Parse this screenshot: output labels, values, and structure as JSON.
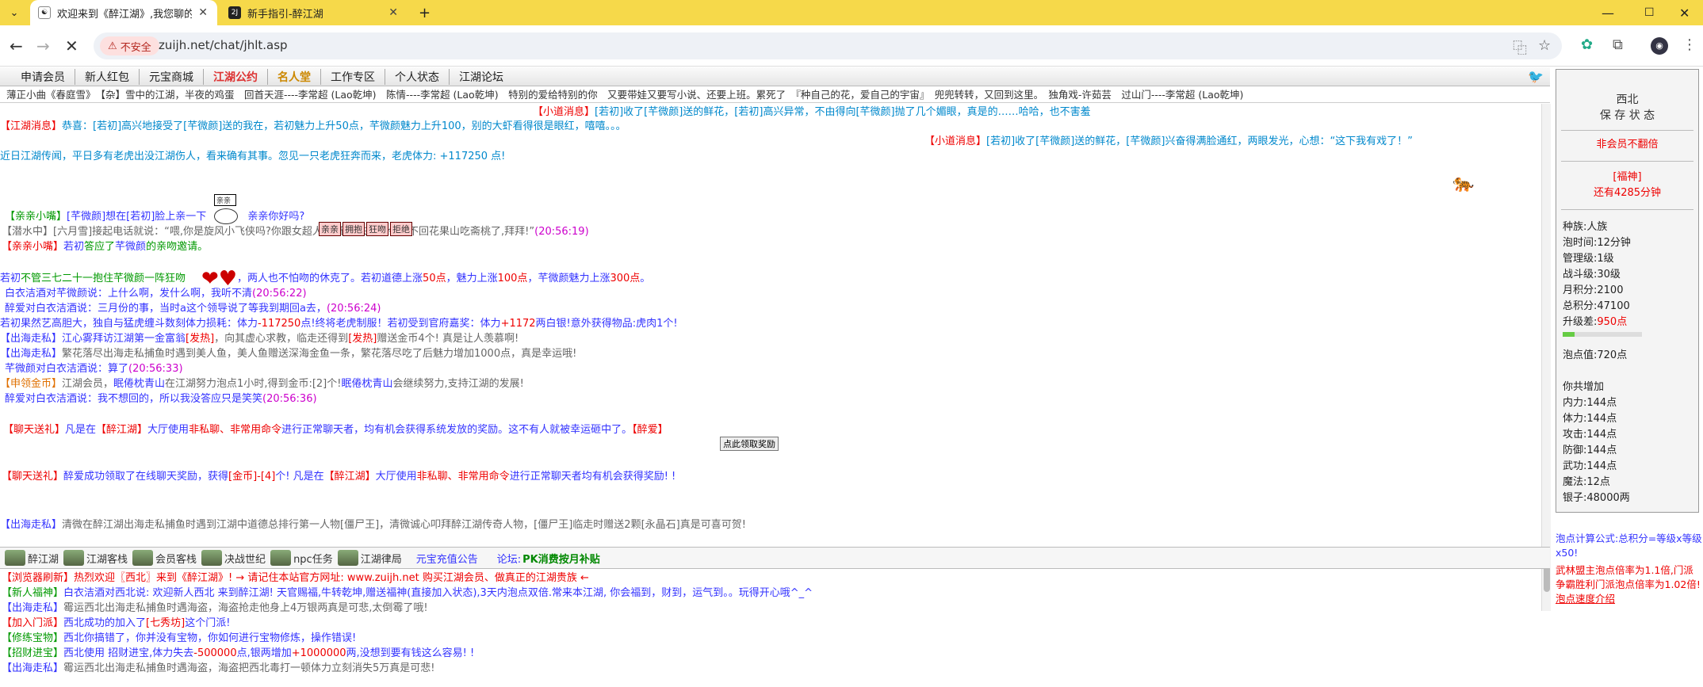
{
  "browser": {
    "tabs": [
      {
        "title": "欢迎来到《醉江湖》,我您聊的天",
        "active": true
      },
      {
        "title": "新手指引-醉江湖",
        "active": false
      }
    ],
    "new_tab": "+",
    "security": "不安全",
    "url": "zuijh.net/chat/jhlt.asp"
  },
  "menu": [
    "申请会员",
    "新人红包",
    "元宝商城",
    "江湖公约",
    "名人堂",
    "工作专区",
    "个人状态",
    "江湖论坛"
  ],
  "ticker": "薄正小曲《春庭雪》　【杂】雪中的江湖，半夜的鸡蛋　回首天涯----李常超 (Lao乾坤)　陈情----李常超 (Lao乾坤)　特别的爱给特别的你　又要带娃又要写小说、还要上班。累死了　『种自己的花，爱自己的宇宙』　兜兜转转，又回到这里。　独角戏-许茹芸　过山门----李常超 (Lao乾坤)",
  "chat": [
    {
      "id": "m1",
      "parts": [
        [
          "r",
          "【小道消息】"
        ],
        [
          "t",
          "[若初]收了[芊微颜]送的鲜花，[若初]高兴异常，不由得向[芊微颜]抛了几个媚眼，真是的……哈哈，也不害羞"
        ]
      ]
    },
    {
      "id": "m2",
      "parts": [
        [
          "r",
          "【江湖消息】"
        ],
        [
          "t",
          "恭喜：[若初]高兴地接受了[芊微颜]送的我在，若初魅力上升50点，芊微颜魅力上升100，别的大虾看得很是眼红，嘻嘻。。。"
        ]
      ]
    },
    {
      "id": "m3",
      "parts": [
        [
          "r",
          "【小道消息】"
        ],
        [
          "t",
          "[若初]收了[芊微颜]送的鲜花，[芊微颜]兴奋得满脸通红，两眼发光，心想：“这下我有戏了！”"
        ]
      ]
    },
    {
      "id": "m4",
      "parts": [
        [
          "t",
          "近日江湖传闻，平日多有老虎出没江湖伤人，看来确有其事。忽见一只老虎狂奔而来，老虎体力: +117250 点!"
        ]
      ]
    },
    {
      "id": "m5",
      "parts": [
        [
          "g",
          "【亲亲小嘴】"
        ],
        [
          "b",
          "[芊微颜]想在[若初]脸上亲一下"
        ],
        [
          "b",
          "　　　　亲亲你好吗?"
        ]
      ]
    },
    {
      "id": "m6",
      "parts": [
        [
          "gr",
          "【潜水中】[六月雪]接起电话就说：“喂,你是旋风小飞侠吗?你跟女超人说,无敌铁金刚今天不回花果山吃斋桃了,拜拜!”"
        ],
        [
          "p",
          "(20:56:19)"
        ]
      ]
    },
    {
      "id": "m7",
      "parts": [
        [
          "r",
          "【亲亲小嘴】"
        ],
        [
          "b",
          "若初"
        ],
        [
          "g",
          "答应了"
        ],
        [
          "b",
          "芊微颜"
        ],
        [
          "g",
          "的亲吻邀请。"
        ]
      ]
    },
    {
      "id": "m8",
      "parts": [
        [
          "b",
          "若初"
        ],
        [
          "g",
          "不管三七二十一抱住芊微颜一阵狂吻"
        ],
        [
          "b",
          "　　　　　，两人也不怕吻的休克了。若初道德上涨"
        ],
        [
          "r",
          "50点"
        ],
        [
          "b",
          "，魅力上涨"
        ],
        [
          "r",
          "100点"
        ],
        [
          "b",
          "，芊微颜魅力上涨"
        ],
        [
          "r",
          "300点"
        ],
        [
          "b",
          "。"
        ]
      ]
    },
    {
      "id": "m9",
      "parts": [
        [
          "b",
          "白衣洁酒对芊微颜说：上什么啊，发什么啊，我听不清"
        ],
        [
          "p",
          "(20:56:22)"
        ]
      ]
    },
    {
      "id": "m10",
      "parts": [
        [
          "b",
          "醉爱对白衣洁酒说：三月份的事，当时a这个领导说了等我到期回a去，"
        ],
        [
          "p",
          "(20:56:24)"
        ]
      ]
    },
    {
      "id": "m11",
      "parts": [
        [
          "b",
          "若初果然艺高胆大，独自与猛虎缠斗数刻体力损耗：体力"
        ],
        [
          "r",
          "-117250"
        ],
        [
          "b",
          "点!终将老虎制服！若初受到官府嘉奖：体力"
        ],
        [
          "r",
          "+1172"
        ],
        [
          "b",
          "两白银!意外获得物品:虎肉1个!"
        ]
      ]
    },
    {
      "id": "m12",
      "parts": [
        [
          "b",
          "【出海走私】江心雾拜访江湖第一金富翁"
        ],
        [
          "r",
          "[发热]"
        ],
        [
          "gr",
          "，向其虚心求教，临走还得到"
        ],
        [
          "r",
          "[发热]"
        ],
        [
          "gr",
          "赠送金币4个! 真是让人羡慕啊!"
        ]
      ]
    },
    {
      "id": "m13",
      "parts": [
        [
          "b",
          "【出海走私】"
        ],
        [
          "gr",
          "繁花落尽出海走私捕鱼时遇到美人鱼，美人鱼赠送深海金鱼一条，繁花落尽吃了后魅力增加1000点，真是幸运哦!"
        ]
      ]
    },
    {
      "id": "m14",
      "parts": [
        [
          "b",
          "芊微颜对白衣洁酒说：算了"
        ],
        [
          "p",
          "(20:56:33)"
        ]
      ]
    },
    {
      "id": "m15",
      "parts": [
        [
          "o",
          "【申领金币】"
        ],
        [
          "gr",
          "江湖会员，"
        ],
        [
          "b",
          "眠倦枕青山"
        ],
        [
          "gr",
          "在江湖努力泡点1小时,得到金币:[2]个!"
        ],
        [
          "b",
          "眠倦枕青山"
        ],
        [
          "gr",
          "会继续努力,支持江湖的发展!"
        ]
      ]
    },
    {
      "id": "m16",
      "parts": [
        [
          "b",
          "醉爱对白衣洁酒说：我不想回的，所以我没答应只是笑笑"
        ],
        [
          "p",
          "(20:56:36)"
        ]
      ]
    },
    {
      "id": "m17",
      "parts": [
        [
          "r",
          "【聊天送礼】"
        ],
        [
          "b",
          "凡是在"
        ],
        [
          "r",
          "【醉江湖】"
        ],
        [
          "b",
          "大厅使用"
        ],
        [
          "r",
          "非私聊、非常用命令"
        ],
        [
          "b",
          "进行正常聊天者，均有机会获得系统发放的奖励。这不有人就被幸运砸中了。"
        ],
        [
          "r",
          "【醉爱】"
        ]
      ]
    },
    {
      "id": "m18",
      "parts": [
        [
          "r",
          "【聊天送礼】"
        ],
        [
          "b",
          "醉爱成功领取了在线聊天奖励，获得"
        ],
        [
          "r",
          "[金币]-[4]"
        ],
        [
          "b",
          "个! 凡是在"
        ],
        [
          "r",
          "【醉江湖】"
        ],
        [
          "b",
          "大厅使用"
        ],
        [
          "r",
          "非私聊、非常用命令"
        ],
        [
          "b",
          "进行正常聊天者均有机会获得奖励! !"
        ]
      ]
    },
    {
      "id": "m19",
      "parts": [
        [
          "b",
          "【出海走私】"
        ],
        [
          "gr",
          "清微在醉江湖出海走私捕鱼时遇到江湖中道德总排行第一人物[僵尸王]，清微诚心叩拜醉江湖传奇人物，[僵尸王]临走时赠送2颗[永晶石]真是可喜可贺!"
        ]
      ]
    }
  ],
  "emotes": [
    "亲亲",
    "拥抱",
    "狂吻",
    "拒绝"
  ],
  "kiss_note": "亲亲",
  "claim_btn": "点此领取奖励",
  "nav": [
    "醉江湖",
    "江湖客栈",
    "会员客栈",
    "决战世纪",
    "npc任务",
    "江湖律局",
    "元宝充值公告",
    "论坛: ",
    "PK消费按月补贴"
  ],
  "sys": [
    {
      "parts": [
        [
          "r",
          "【浏览器刷新】热烈欢迎〖西北〗来到《醉江湖》! → 请记住本站官方网址: www.zuijh.net 购买江湖会员、做真正的江湖贵族 ←"
        ]
      ]
    },
    {
      "parts": [
        [
          "g",
          "【新人福神】"
        ],
        [
          "b",
          "白衣洁酒对西北说: 欢迎新人西北 来到醉江湖! 天官赐福,牛转乾坤,赠送福神(直接加入状态),3天内泡点双倍.常来本江湖, 你会福到，财到，运气到。。玩得开心哦^_^"
        ]
      ]
    },
    {
      "parts": [
        [
          "b",
          "【出海走私】"
        ],
        [
          "gr",
          "霉运西北出海走私捕鱼时遇海盗，海盗抢走他身上4万银两真是可悲,太倒霉了哦!"
        ]
      ]
    },
    {
      "parts": [
        [
          "r",
          "【加入门派】"
        ],
        [
          "b",
          "西北成功的加入了"
        ],
        [
          "r",
          "[七秀坊]"
        ],
        [
          "b",
          "这个门派!"
        ]
      ]
    },
    {
      "parts": [
        [
          "g",
          "【修练宝物】"
        ],
        [
          "b",
          "西北你搞错了，你并没有宝物，你如何进行宝物修炼，操作错误!"
        ]
      ]
    },
    {
      "parts": [
        [
          "g",
          "【招财进宝】"
        ],
        [
          "b",
          "西北使用 招财进宝,体力失去"
        ],
        [
          "r",
          "-500000"
        ],
        [
          "b",
          "点,银两增加"
        ],
        [
          "r",
          "+1000000"
        ],
        [
          "b",
          "两,没想到要有钱这么容易! !"
        ]
      ]
    },
    {
      "parts": [
        [
          "b",
          "【出海走私】"
        ],
        [
          "gr",
          "霉运西北出海走私捕鱼时遇海盗，海盗把西北毒打一顿体力立刻消失5万真是可悲!"
        ]
      ]
    }
  ],
  "sidebar": {
    "name": "西北",
    "state": "保 存 状 态",
    "member": "非会员不翻倍",
    "blessing": "[福神]",
    "remaining": "还有4285分钟",
    "stats": [
      "种族:人族",
      "泡时间:12分钟",
      "管理级:1级",
      "战斗级:30级",
      "月积分:2100",
      "总积分:47100"
    ],
    "upgrade_label": "升级差:",
    "upgrade_value": "950点",
    "upgrade_progress": 0.15,
    "paodian": "泡点值:720点",
    "total_label": "你共增加",
    "gains": [
      "内力:144点",
      "体力:144点",
      "攻击:144点",
      "防御:144点",
      "武功:144点",
      "魔法:12点",
      "银子:48000两"
    ]
  },
  "formula": {
    "blue": "泡点计算公式:总积分=等级x等级x50!",
    "red": "武林盟主泡点倍率为1.1倍,门派争霸胜利门派泡点倍率为1.02倍!",
    "link": "泡点速度介绍"
  }
}
